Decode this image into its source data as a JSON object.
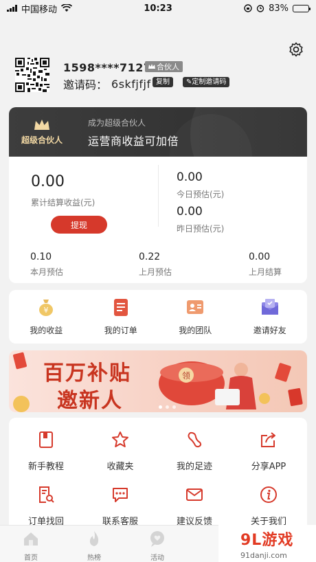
{
  "status_bar": {
    "carrier": "中国移动",
    "time": "10:23",
    "battery": "83%",
    "battery_level": 0.83
  },
  "header": {
    "phone": "1598****7127",
    "partner_badge": "合伙人",
    "invite_label": "邀请码：",
    "invite_code": "6skfjfjf",
    "copy_label": "复制",
    "custom_label": "定制邀请码"
  },
  "promo": {
    "badge": "超级合伙人",
    "line1": "成为超级合伙人",
    "line2": "运营商收益可加倍"
  },
  "earnings": {
    "total_value": "0.00",
    "total_label": "累计结算收益(元)",
    "withdraw_label": "提现",
    "today_value": "0.00",
    "today_label": "今日预估(元)",
    "yesterday_value": "0.00",
    "yesterday_label": "昨日预估(元)",
    "stats": [
      {
        "value": "0.10",
        "label": "本月预估"
      },
      {
        "value": "0.22",
        "label": "上月预估"
      },
      {
        "value": "0.00",
        "label": "上月结算"
      }
    ]
  },
  "quick_menu": [
    {
      "label": "我的收益",
      "icon": "money-bag-icon"
    },
    {
      "label": "我的订单",
      "icon": "order-list-icon"
    },
    {
      "label": "我的团队",
      "icon": "team-card-icon"
    },
    {
      "label": "邀请好友",
      "icon": "invite-envelope-icon"
    }
  ],
  "banner": {
    "line1": "百万补贴",
    "line2": "邀新人"
  },
  "tools": [
    {
      "label": "新手教程",
      "icon": "book-icon"
    },
    {
      "label": "收藏夹",
      "icon": "star-icon"
    },
    {
      "label": "我的足迹",
      "icon": "footprint-icon"
    },
    {
      "label": "分享APP",
      "icon": "share-icon"
    },
    {
      "label": "订单找回",
      "icon": "order-search-icon"
    },
    {
      "label": "联系客服",
      "icon": "chat-icon"
    },
    {
      "label": "建议反馈",
      "icon": "mail-icon"
    },
    {
      "label": "关于我们",
      "icon": "info-icon"
    }
  ],
  "tabbar": [
    {
      "label": "首页",
      "icon": "home-icon"
    },
    {
      "label": "热榜",
      "icon": "flame-icon"
    },
    {
      "label": "活动",
      "icon": "heart-chat-icon"
    }
  ],
  "watermark": {
    "text": "9L游戏",
    "url": "91danji.com"
  },
  "colors": {
    "accent": "#d6392b",
    "dark_card": "#333333",
    "gold": "#f3d9a4"
  }
}
